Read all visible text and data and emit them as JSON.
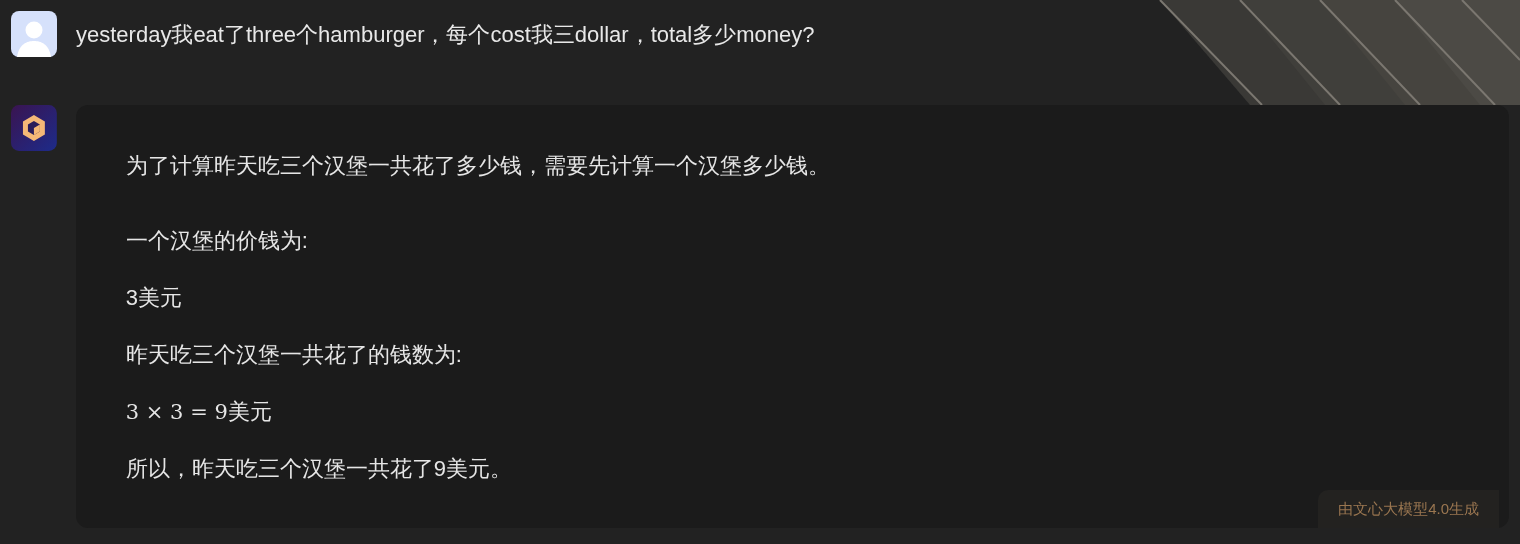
{
  "user_message": {
    "text": "yesterday我eat了three个hamburger，每个cost我三dollar，total多少money?"
  },
  "answer": {
    "paragraphs": [
      {
        "kind": "text",
        "text": "为了计算昨天吃三个汉堡一共花了多少钱，需要先计算一个汉堡多少钱。"
      },
      {
        "kind": "text",
        "text": "一个汉堡的价钱为:"
      },
      {
        "kind": "text",
        "text": "3美元"
      },
      {
        "kind": "text",
        "text": "昨天吃三个汉堡一共花了的钱数为:"
      },
      {
        "kind": "formula",
        "math": "3 × 3 = 9",
        "suffix": "美元"
      },
      {
        "kind": "text",
        "text": "所以，昨天吃三个汉堡一共花了9美元。"
      }
    ],
    "badge": "由文心大模型4.0生成"
  }
}
